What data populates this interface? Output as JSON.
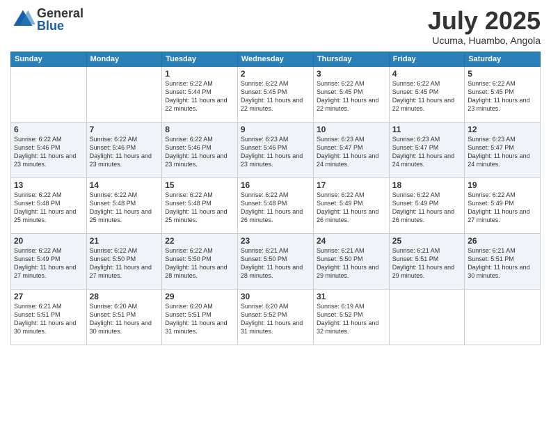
{
  "logo": {
    "general": "General",
    "blue": "Blue"
  },
  "title": "July 2025",
  "subtitle": "Ucuma, Huambo, Angola",
  "header_days": [
    "Sunday",
    "Monday",
    "Tuesday",
    "Wednesday",
    "Thursday",
    "Friday",
    "Saturday"
  ],
  "weeks": [
    [
      {
        "day": "",
        "info": ""
      },
      {
        "day": "",
        "info": ""
      },
      {
        "day": "1",
        "info": "Sunrise: 6:22 AM\nSunset: 5:44 PM\nDaylight: 11 hours and 22 minutes."
      },
      {
        "day": "2",
        "info": "Sunrise: 6:22 AM\nSunset: 5:45 PM\nDaylight: 11 hours and 22 minutes."
      },
      {
        "day": "3",
        "info": "Sunrise: 6:22 AM\nSunset: 5:45 PM\nDaylight: 11 hours and 22 minutes."
      },
      {
        "day": "4",
        "info": "Sunrise: 6:22 AM\nSunset: 5:45 PM\nDaylight: 11 hours and 22 minutes."
      },
      {
        "day": "5",
        "info": "Sunrise: 6:22 AM\nSunset: 5:45 PM\nDaylight: 11 hours and 23 minutes."
      }
    ],
    [
      {
        "day": "6",
        "info": "Sunrise: 6:22 AM\nSunset: 5:46 PM\nDaylight: 11 hours and 23 minutes."
      },
      {
        "day": "7",
        "info": "Sunrise: 6:22 AM\nSunset: 5:46 PM\nDaylight: 11 hours and 23 minutes."
      },
      {
        "day": "8",
        "info": "Sunrise: 6:22 AM\nSunset: 5:46 PM\nDaylight: 11 hours and 23 minutes."
      },
      {
        "day": "9",
        "info": "Sunrise: 6:23 AM\nSunset: 5:46 PM\nDaylight: 11 hours and 23 minutes."
      },
      {
        "day": "10",
        "info": "Sunrise: 6:23 AM\nSunset: 5:47 PM\nDaylight: 11 hours and 24 minutes."
      },
      {
        "day": "11",
        "info": "Sunrise: 6:23 AM\nSunset: 5:47 PM\nDaylight: 11 hours and 24 minutes."
      },
      {
        "day": "12",
        "info": "Sunrise: 6:23 AM\nSunset: 5:47 PM\nDaylight: 11 hours and 24 minutes."
      }
    ],
    [
      {
        "day": "13",
        "info": "Sunrise: 6:22 AM\nSunset: 5:48 PM\nDaylight: 11 hours and 25 minutes."
      },
      {
        "day": "14",
        "info": "Sunrise: 6:22 AM\nSunset: 5:48 PM\nDaylight: 11 hours and 25 minutes."
      },
      {
        "day": "15",
        "info": "Sunrise: 6:22 AM\nSunset: 5:48 PM\nDaylight: 11 hours and 25 minutes."
      },
      {
        "day": "16",
        "info": "Sunrise: 6:22 AM\nSunset: 5:48 PM\nDaylight: 11 hours and 26 minutes."
      },
      {
        "day": "17",
        "info": "Sunrise: 6:22 AM\nSunset: 5:49 PM\nDaylight: 11 hours and 26 minutes."
      },
      {
        "day": "18",
        "info": "Sunrise: 6:22 AM\nSunset: 5:49 PM\nDaylight: 11 hours and 26 minutes."
      },
      {
        "day": "19",
        "info": "Sunrise: 6:22 AM\nSunset: 5:49 PM\nDaylight: 11 hours and 27 minutes."
      }
    ],
    [
      {
        "day": "20",
        "info": "Sunrise: 6:22 AM\nSunset: 5:49 PM\nDaylight: 11 hours and 27 minutes."
      },
      {
        "day": "21",
        "info": "Sunrise: 6:22 AM\nSunset: 5:50 PM\nDaylight: 11 hours and 27 minutes."
      },
      {
        "day": "22",
        "info": "Sunrise: 6:22 AM\nSunset: 5:50 PM\nDaylight: 11 hours and 28 minutes."
      },
      {
        "day": "23",
        "info": "Sunrise: 6:21 AM\nSunset: 5:50 PM\nDaylight: 11 hours and 28 minutes."
      },
      {
        "day": "24",
        "info": "Sunrise: 6:21 AM\nSunset: 5:50 PM\nDaylight: 11 hours and 29 minutes."
      },
      {
        "day": "25",
        "info": "Sunrise: 6:21 AM\nSunset: 5:51 PM\nDaylight: 11 hours and 29 minutes."
      },
      {
        "day": "26",
        "info": "Sunrise: 6:21 AM\nSunset: 5:51 PM\nDaylight: 11 hours and 30 minutes."
      }
    ],
    [
      {
        "day": "27",
        "info": "Sunrise: 6:21 AM\nSunset: 5:51 PM\nDaylight: 11 hours and 30 minutes."
      },
      {
        "day": "28",
        "info": "Sunrise: 6:20 AM\nSunset: 5:51 PM\nDaylight: 11 hours and 30 minutes."
      },
      {
        "day": "29",
        "info": "Sunrise: 6:20 AM\nSunset: 5:51 PM\nDaylight: 11 hours and 31 minutes."
      },
      {
        "day": "30",
        "info": "Sunrise: 6:20 AM\nSunset: 5:52 PM\nDaylight: 11 hours and 31 minutes."
      },
      {
        "day": "31",
        "info": "Sunrise: 6:19 AM\nSunset: 5:52 PM\nDaylight: 11 hours and 32 minutes."
      },
      {
        "day": "",
        "info": ""
      },
      {
        "day": "",
        "info": ""
      }
    ]
  ]
}
